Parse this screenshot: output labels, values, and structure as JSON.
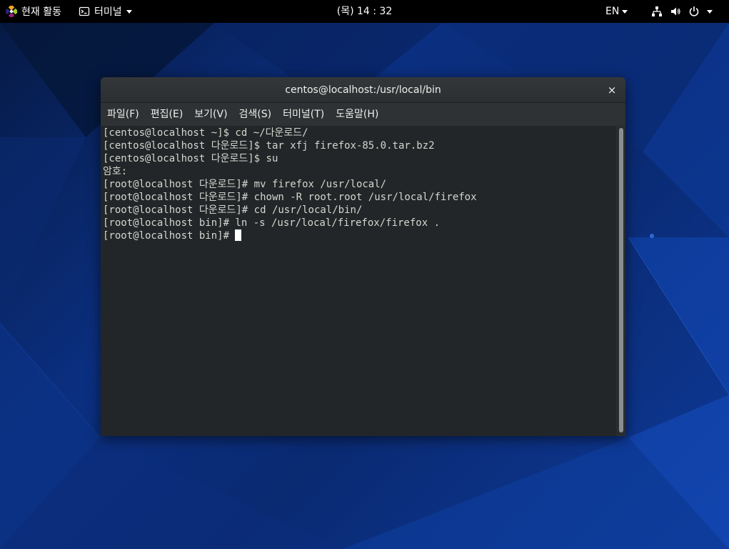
{
  "topbar": {
    "activities_label": "현재 활동",
    "app_menu_label": "터미널",
    "clock": "(목) 14 : 32",
    "language": "EN"
  },
  "window": {
    "title": "centos@localhost:/usr/local/bin",
    "close_symbol": "×"
  },
  "menubar": {
    "items": [
      {
        "label": "파일(F)"
      },
      {
        "label": "편집(E)"
      },
      {
        "label": "보기(V)"
      },
      {
        "label": "검색(S)"
      },
      {
        "label": "터미널(T)"
      },
      {
        "label": "도움말(H)"
      }
    ]
  },
  "terminal": {
    "lines": [
      "[centos@localhost ~]$ cd ~/다운로드/",
      "[centos@localhost 다운로드]$ tar xfj firefox-85.0.tar.bz2",
      "[centos@localhost 다운로드]$ su",
      "암호:",
      "[root@localhost 다운로드]# mv firefox /usr/local/",
      "[root@localhost 다운로드]# chown -R root.root /usr/local/firefox",
      "[root@localhost 다운로드]# cd /usr/local/bin/",
      "[root@localhost bin]# ln -s /usr/local/firefox/firefox .",
      "[root@localhost bin]# "
    ]
  },
  "colors": {
    "topbar_bg": "#000000",
    "terminal_bg": "#232628",
    "terminal_fg": "#d3d7cf",
    "desktop_blue": "#0b2f80"
  }
}
